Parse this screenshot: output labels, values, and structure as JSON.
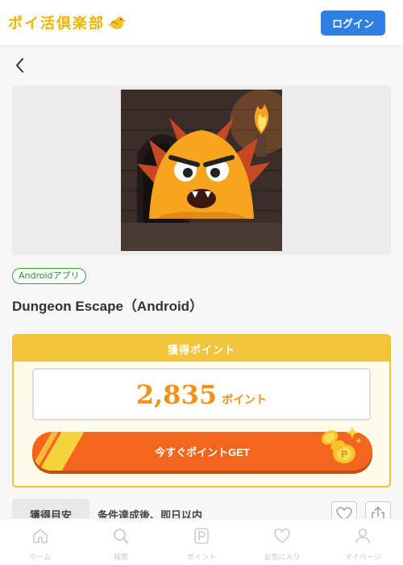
{
  "header": {
    "logo_text": "ポイ活倶楽部",
    "login_label": "ログイン"
  },
  "offer": {
    "badge": "Androidアプリ",
    "title": "Dungeon Escape（Android）"
  },
  "points": {
    "heading": "獲得ポイント",
    "value": "2,835",
    "unit": "ポイント",
    "cta_label": "今すぐポイントGET"
  },
  "earn": {
    "label": "獲得目安",
    "value": "条件達成後、即日以内"
  },
  "bottom_nav": {
    "items": [
      {
        "label": "ホーム",
        "icon": "home-icon"
      },
      {
        "label": "検索",
        "icon": "search-icon"
      },
      {
        "label": "ポイント",
        "icon": "point-icon"
      },
      {
        "label": "お気に入り",
        "icon": "heart-icon"
      },
      {
        "label": "マイページ",
        "icon": "user-icon"
      }
    ]
  },
  "colors": {
    "accent_blue": "#2f7fe0",
    "gold": "#f2c43c",
    "orange": "#f4661e",
    "points_orange": "#f0921b",
    "green": "#3aa23a"
  }
}
